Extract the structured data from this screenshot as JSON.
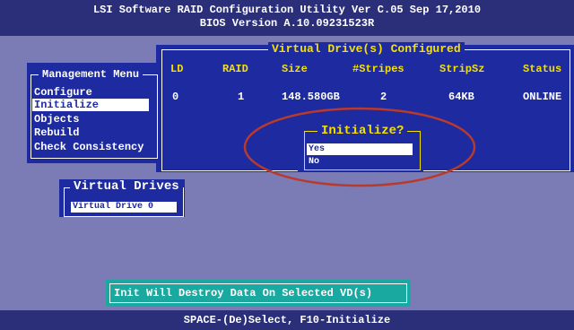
{
  "header": {
    "line1": "LSI Software RAID Configuration Utility Ver C.05 Sep 17,2010",
    "line2": "BIOS Version  A.10.09231523R"
  },
  "vd_panel": {
    "title": "Virtual Drive(s) Configured",
    "columns": [
      "LD",
      "RAID",
      "Size",
      "#Stripes",
      "StripSz",
      "Status"
    ],
    "rows": [
      [
        "0",
        "1",
        "148.580GB",
        "2",
        "64KB",
        "ONLINE"
      ]
    ]
  },
  "management_menu": {
    "title": "Management Menu",
    "items": [
      "Configure",
      "Initialize",
      "Objects",
      "Rebuild",
      "Check Consistency"
    ],
    "selected": "Initialize"
  },
  "initialize_dialog": {
    "title": "Initialize?",
    "options": [
      "Yes",
      "No"
    ],
    "selected": "Yes"
  },
  "virtual_drives": {
    "title": "Virtual Drives",
    "items": [
      "Virtual Drive 0"
    ]
  },
  "warning": "Init Will Destroy Data On Selected VD(s)",
  "footer": "SPACE-(De)Select, F10-Initialize",
  "colors": {
    "background": "#7b7bb5",
    "panel": "#1d2aa0",
    "bar": "#2b2f7a",
    "highlight_text": "#f5e000",
    "warning_bg": "#1aa9a0",
    "annotation_ellipse": "#b83a2a"
  }
}
